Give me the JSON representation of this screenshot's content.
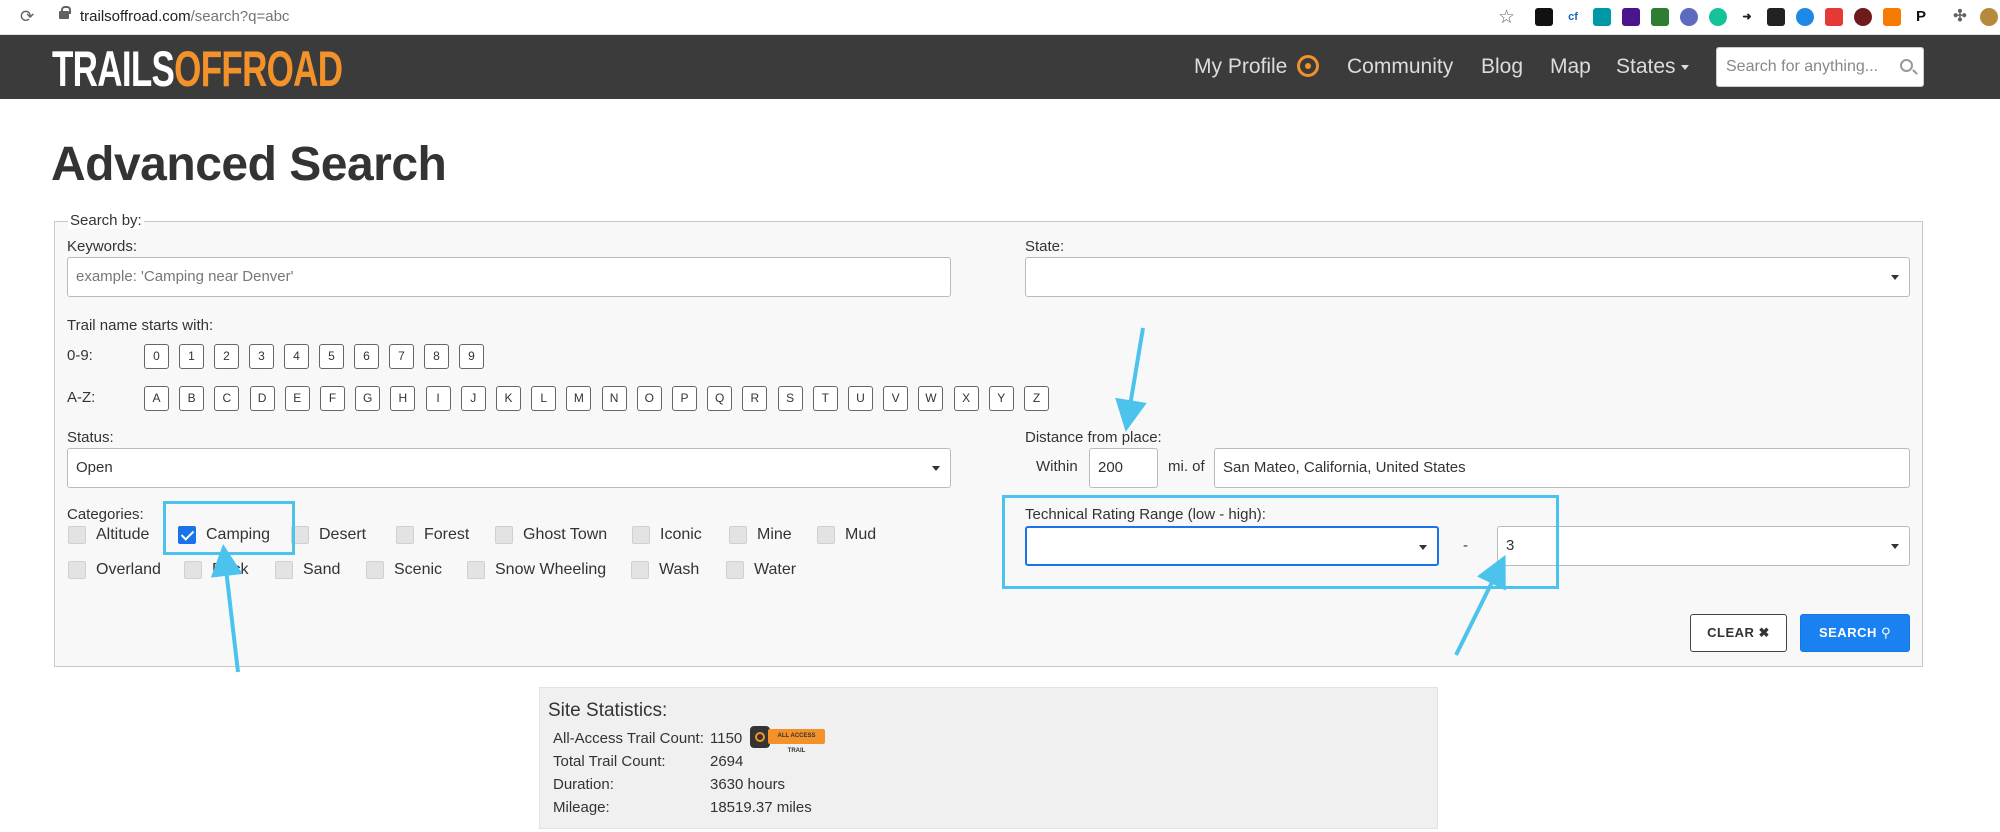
{
  "browser": {
    "url_host": "trailsoffroad.com",
    "url_path": "/search?q=abc"
  },
  "nav": {
    "logo_white": "TRAILS",
    "logo_orange": "OFFROAD",
    "my_profile": "My Profile",
    "community": "Community",
    "blog": "Blog",
    "map": "Map",
    "states": "States",
    "search_placeholder": "Search for anything..."
  },
  "page": {
    "title": "Advanced Search"
  },
  "form": {
    "legend": "Search by:",
    "keywords_label": "Keywords:",
    "keywords_placeholder": "example: 'Camping near Denver'",
    "state_label": "State:",
    "state_value": "",
    "trail_name_label": "Trail name starts with:",
    "digits_label": "0-9:",
    "digits": [
      "0",
      "1",
      "2",
      "3",
      "4",
      "5",
      "6",
      "7",
      "8",
      "9"
    ],
    "letters_label": "A-Z:",
    "letters": [
      "A",
      "B",
      "C",
      "D",
      "E",
      "F",
      "G",
      "H",
      "I",
      "J",
      "K",
      "L",
      "M",
      "N",
      "O",
      "P",
      "Q",
      "R",
      "S",
      "T",
      "U",
      "V",
      "W",
      "X",
      "Y",
      "Z"
    ],
    "status_label": "Status:",
    "status_value": "Open",
    "distance_label": "Distance from place:",
    "within_label": "Within",
    "distance_value": "200",
    "mi_of_label": "mi. of",
    "place_value": "San Mateo, California, United States",
    "categories_label": "Categories:",
    "categories": [
      {
        "label": "Altitude",
        "checked": false
      },
      {
        "label": "Camping",
        "checked": true
      },
      {
        "label": "Desert",
        "checked": false
      },
      {
        "label": "Forest",
        "checked": false
      },
      {
        "label": "Ghost Town",
        "checked": false
      },
      {
        "label": "Iconic",
        "checked": false
      },
      {
        "label": "Mine",
        "checked": false
      },
      {
        "label": "Mud",
        "checked": false
      },
      {
        "label": "Overland",
        "checked": false
      },
      {
        "label": "Rock",
        "checked": false
      },
      {
        "label": "Sand",
        "checked": false
      },
      {
        "label": "Scenic",
        "checked": false
      },
      {
        "label": "Snow Wheeling",
        "checked": false
      },
      {
        "label": "Wash",
        "checked": false
      },
      {
        "label": "Water",
        "checked": false
      }
    ],
    "rating_label": "Technical Rating Range (low - high):",
    "rating_low": "",
    "rating_dash": "-",
    "rating_high": "3",
    "clear_button": "CLEAR ✖",
    "search_button": "SEARCH"
  },
  "stats": {
    "title": "Site Statistics:",
    "rows": [
      {
        "label": "All-Access Trail Count:",
        "value": "1150"
      },
      {
        "label": "Total Trail Count:",
        "value": "2694"
      },
      {
        "label": "Duration:",
        "value": "3630 hours"
      },
      {
        "label": "Mileage:",
        "value": "18519.37 miles"
      }
    ],
    "badge_text": "ALL ACCESS TRAIL"
  },
  "colors": {
    "brand_orange": "#f3922a",
    "nav_bg": "#3b3b3b",
    "primary_blue": "#1a82f0",
    "annotation": "#4cc3ec"
  }
}
